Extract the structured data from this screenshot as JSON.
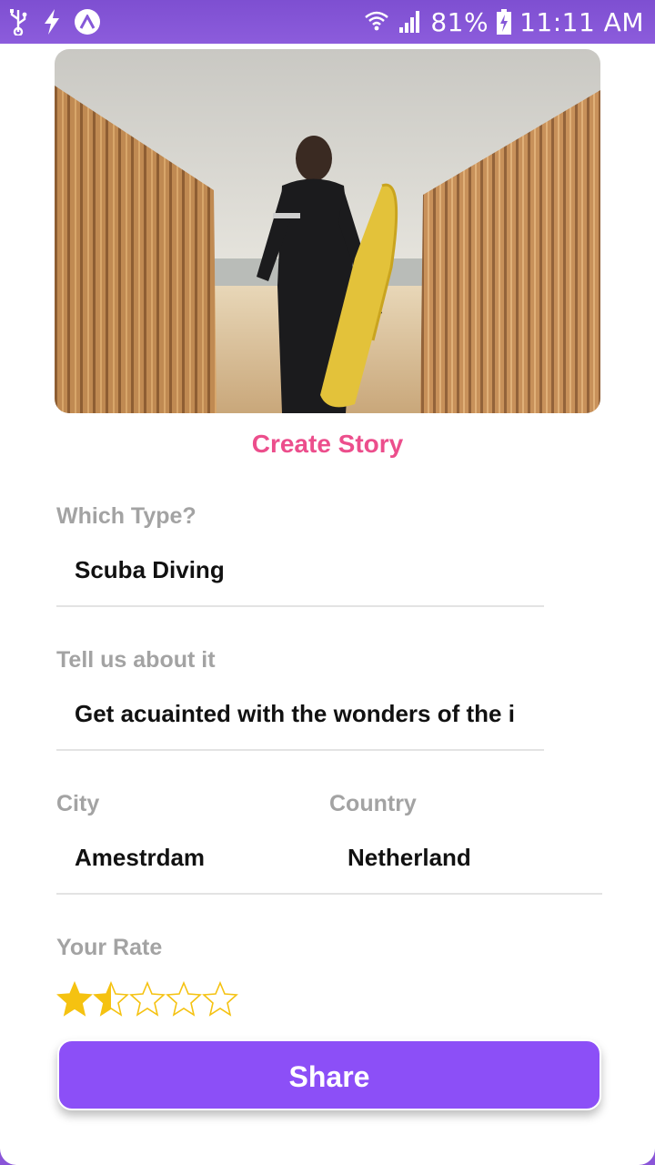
{
  "status_bar": {
    "battery": "81%",
    "time": "11:11 AM",
    "icons": [
      "usb-icon",
      "flash-icon",
      "app-a-icon",
      "wifi-icon",
      "signal-icon",
      "battery-charging-icon"
    ]
  },
  "story": {
    "title": "Create Story",
    "image": "surfer-with-yellow-board-beach-photo"
  },
  "form": {
    "type_label": "Which Type?",
    "type_value": "Scuba Diving",
    "about_label": "Tell us about it",
    "about_value": "Get acuainted with the wonders of the i",
    "city_label": "City",
    "city_value": "Amestrdam",
    "country_label": "Country",
    "country_value": "Netherland",
    "rate_label": "Your Rate",
    "rating": 1.5,
    "rating_max": 5
  },
  "actions": {
    "share_label": "Share"
  },
  "colors": {
    "accent": "#8c4ff7",
    "title_pink": "#ec4e8c",
    "statusbar": "#8558d8",
    "star": "#f5c211"
  }
}
